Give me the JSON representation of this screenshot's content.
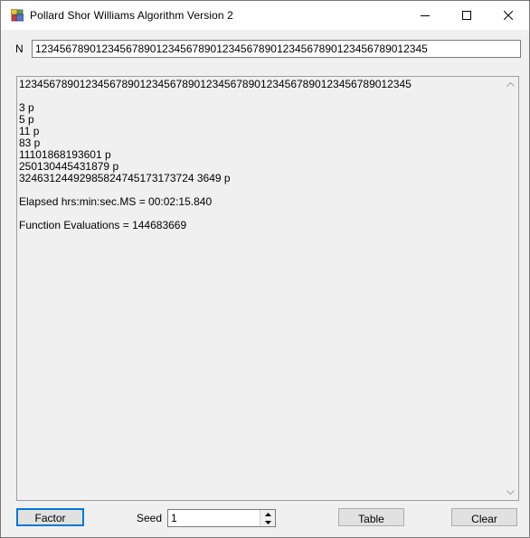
{
  "window": {
    "title": "Pollard Shor Williams Algorithm Version 2",
    "minimize": "minimize",
    "maximize": "maximize",
    "close": "close"
  },
  "n_field": {
    "label": "N",
    "value": "12345678901234567890123456789012345678901234567890123456789012345"
  },
  "output": {
    "lines": [
      "12345678901234567890123456789012345678901234567890123456789012345",
      "",
      "3 p",
      "5 p",
      "11 p",
      "83 p",
      "11101868193601 p",
      "250130445431879 p",
      "32463124492985824745173173724 3649 p",
      "",
      "Elapsed hrs:min:sec.MS = 00:02:15.840",
      "",
      "Function Evaluations = 144683669"
    ]
  },
  "controls": {
    "factor_label": "Factor",
    "seed_label": "Seed",
    "seed_value": "1",
    "table_label": "Table",
    "clear_label": "Clear"
  }
}
